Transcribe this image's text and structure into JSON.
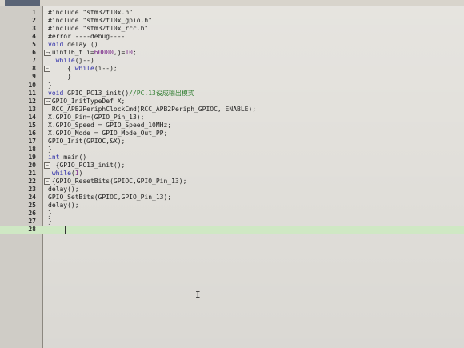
{
  "editor": {
    "lines": [
      {
        "n": "1",
        "text": "#include \"stm32f10x.h\""
      },
      {
        "n": "2",
        "text": "#include \"stm32f10x_gpio.h\""
      },
      {
        "n": "3",
        "text": "#include \"stm32f10x_rcc.h\""
      },
      {
        "n": "4",
        "text": "#error ----debug----"
      },
      {
        "n": "5",
        "text": "void delay ()"
      },
      {
        "n": "6",
        "text": "{uint16_t i=60000,j=10;"
      },
      {
        "n": "7",
        "text": "  while(j--)"
      },
      {
        "n": "8",
        "text": "     { while(i--);"
      },
      {
        "n": "9",
        "text": "     }"
      },
      {
        "n": "10",
        "text": "}"
      },
      {
        "n": "11",
        "text": "void GPIO_PC13_init()//PC.13设成输出模式"
      },
      {
        "n": "12",
        "text": "{GPIO_InitTypeDef X;"
      },
      {
        "n": "13",
        "text": " RCC_APB2PeriphClockCmd(RCC_APB2Periph_GPIOC, ENABLE);"
      },
      {
        "n": "14",
        "text": "X.GPIO_Pin=(GPIO_Pin_13);"
      },
      {
        "n": "15",
        "text": "X.GPIO_Speed = GPIO_Speed_10MHz;"
      },
      {
        "n": "16",
        "text": "X.GPIO_Mode = GPIO_Mode_Out_PP;"
      },
      {
        "n": "17",
        "text": "GPIO_Init(GPIOC,&X);"
      },
      {
        "n": "18",
        "text": "}"
      },
      {
        "n": "19",
        "text": "int main()"
      },
      {
        "n": "20",
        "text": "  {GPIO_PC13_init();"
      },
      {
        "n": "21",
        "text": " while(1)"
      },
      {
        "n": "22",
        "text": " {GPIO_ResetBits(GPIOC,GPIO_Pin_13);"
      },
      {
        "n": "23",
        "text": "delay();"
      },
      {
        "n": "24",
        "text": "GPIO_SetBits(GPIOC,GPIO_Pin_13);"
      },
      {
        "n": "25",
        "text": "delay();"
      },
      {
        "n": "26",
        "text": "}"
      },
      {
        "n": "27",
        "text": "}"
      },
      {
        "n": "28",
        "text": ""
      }
    ],
    "current_line": "28",
    "fold_lines": [
      "6",
      "8",
      "12",
      "20",
      "22"
    ],
    "colors": {
      "current_line_bg": "#cfe8c4",
      "keyword": "#2a2aa8",
      "number": "#7a2a8a",
      "comment": "#2f7d2f"
    }
  },
  "cursor": {
    "icon": "i-beam-cursor-icon",
    "glyph": "I"
  }
}
